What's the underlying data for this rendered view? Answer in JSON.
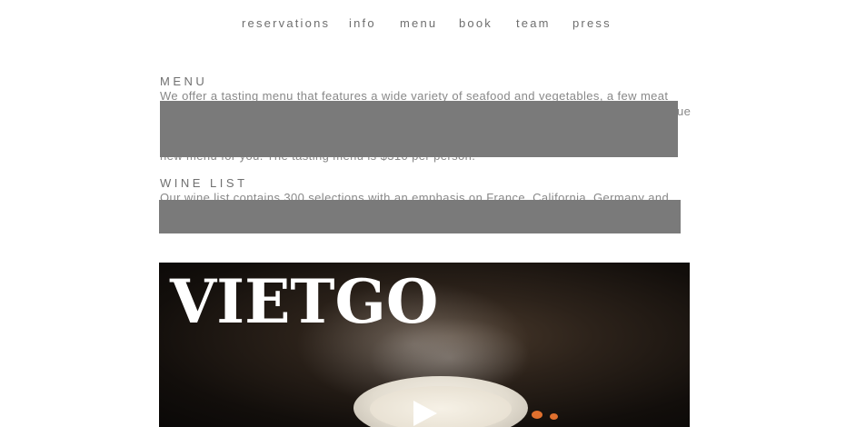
{
  "nav": {
    "items": [
      {
        "label": "reservations"
      },
      {
        "label": "info"
      },
      {
        "label": "menu"
      },
      {
        "label": "book"
      },
      {
        "label": "team"
      },
      {
        "label": "press"
      }
    ]
  },
  "menu_section": {
    "title": "MENU",
    "line1": "We offer a tasting menu that features a wide variety of seafood and vegetables, a few meat",
    "line2_partial": "ue",
    "last_line": "new menu for you. The tasting menu is $310 per person."
  },
  "wine_section": {
    "title": "WINE LIST",
    "line1": "Our wine list contains 300 selections with an emphasis on France, California, Germany and"
  },
  "video": {
    "logo_text": "VIETGO",
    "play_icon": "play-icon"
  },
  "colors": {
    "redaction": "#7a7a7a",
    "text": "#888888",
    "nav_text": "#6e6e6e"
  }
}
